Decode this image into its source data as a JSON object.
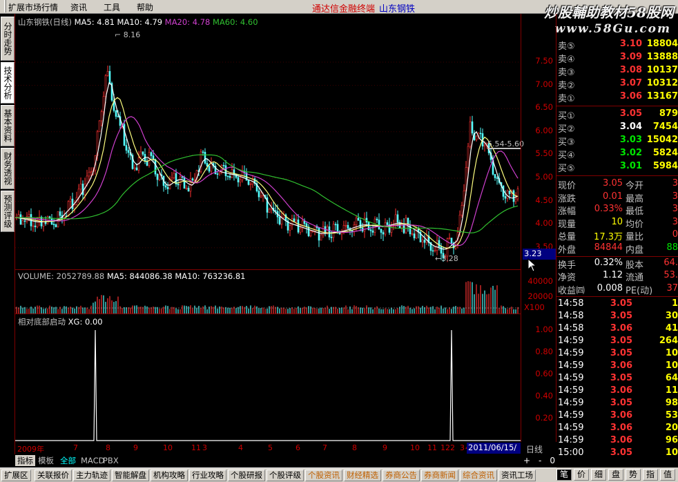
{
  "menu": [
    "扩展市场行情",
    "资讯",
    "工具",
    "帮助"
  ],
  "title": {
    "app": "通达信金融终端",
    "stock": "山东钢铁"
  },
  "watermark": {
    "line1": "炒股輔助教材58股网",
    "line2": "www.58Gu.com"
  },
  "left_tabs": [
    "分时走势",
    "技术分析",
    "基本资料",
    "财务透视",
    "预测评级"
  ],
  "main_legend": {
    "name": "山东钢铁(日线)",
    "ma5": "MA5: 4.81",
    "ma10": "MA10: 4.79",
    "ma20": "MA20: 4.78",
    "ma60": "MA60: 4.60"
  },
  "annotations": {
    "high": "8.16",
    "low": "3.28",
    "range": "5.54-5.60"
  },
  "volume_legend": {
    "vol": "VOLUME: 2052789.88",
    "ma5": "MA5: 844086.38",
    "ma10": "MA10: 763236.81"
  },
  "indicator_legend": {
    "name": "相对底部启动",
    "xg": "XG: 0.00"
  },
  "price_axis": [
    "7.50",
    "7.00",
    "6.50",
    "6.00",
    "5.50",
    "5.00",
    "4.50",
    "4.00",
    "3.50"
  ],
  "current_price_tag": "3.23",
  "volume_axis": [
    "40000",
    "20000",
    "X100"
  ],
  "indicator_axis": [
    "1.00",
    "0.80",
    "0.60",
    "0.40",
    "0.20"
  ],
  "time_axis": {
    "labels": [
      "2009年",
      "7",
      "8",
      "9",
      "10",
      "11",
      "3",
      "4",
      "5",
      "6",
      "7",
      "8",
      "9",
      "10",
      "11",
      "12",
      "2",
      "3",
      "4"
    ],
    "cursor_date": "2011/06/15/三"
  },
  "period": "日线",
  "zoom_buttons": [
    "+",
    "-",
    "0"
  ],
  "bottom_tabs": [
    "指标",
    "模板",
    "全部",
    "MACD",
    "PBX"
  ],
  "status_buttons": [
    "扩展区",
    "关联报价",
    "主力轨迹",
    "智能解盘",
    "机构攻略",
    "行业攻略",
    "个股研报",
    "个股评级",
    "个股资讯",
    "财经精选",
    "券商公告",
    "券商新闻",
    "综合资讯",
    "资讯工场"
  ],
  "quote_tabs": [
    "笔",
    "价",
    "细",
    "盘",
    "势",
    "指",
    "值"
  ],
  "order_book": {
    "sell": [
      {
        "label": "卖⑤",
        "price": "3.10",
        "vol": "18804"
      },
      {
        "label": "卖④",
        "price": "3.09",
        "vol": "13888"
      },
      {
        "label": "卖③",
        "price": "3.08",
        "vol": "10137"
      },
      {
        "label": "卖②",
        "price": "3.07",
        "vol": "10312"
      },
      {
        "label": "卖①",
        "price": "3.06",
        "vol": "13167"
      }
    ],
    "buy": [
      {
        "label": "买①",
        "price": "3.05",
        "vol": "879"
      },
      {
        "label": "买②",
        "price": "3.04",
        "vol": "7454"
      },
      {
        "label": "买③",
        "price": "3.03",
        "vol": "15042"
      },
      {
        "label": "买④",
        "price": "3.02",
        "vol": "5824"
      },
      {
        "label": "买⑤",
        "price": "3.01",
        "vol": "5984"
      }
    ]
  },
  "stats": [
    {
      "k1": "现价",
      "v1": "3.05",
      "k2": "今开",
      "v2": "3"
    },
    {
      "k1": "涨跌",
      "v1": "0.01",
      "k2": "最高",
      "v2": "3"
    },
    {
      "k1": "涨幅",
      "v1": "0.33%",
      "k2": "最低",
      "v2": "3"
    },
    {
      "k1": "现量",
      "v1": "10",
      "k2": "均价",
      "v2": "3"
    },
    {
      "k1": "总量",
      "v1": "17.3万",
      "k2": "量比",
      "v2": "0"
    },
    {
      "k1": "外盘",
      "v1": "84844",
      "k2": "内盘",
      "v2": "88"
    },
    {
      "k1": "换手",
      "v1": "0.32%",
      "k2": "股本",
      "v2": "64."
    },
    {
      "k1": "净资",
      "v1": "1.12",
      "k2": "流通",
      "v2": "53."
    },
    {
      "k1": "收益㈣",
      "v1": "0.008",
      "k2": "PE(动)",
      "v2": "37"
    }
  ],
  "ticks": [
    {
      "t": "14:58",
      "p": "3.05",
      "v": "1"
    },
    {
      "t": "14:58",
      "p": "3.05",
      "v": "30"
    },
    {
      "t": "14:58",
      "p": "3.06",
      "v": "41"
    },
    {
      "t": "14:59",
      "p": "3.05",
      "v": "264"
    },
    {
      "t": "14:59",
      "p": "3.05",
      "v": "10"
    },
    {
      "t": "14:59",
      "p": "3.06",
      "v": "10"
    },
    {
      "t": "14:59",
      "p": "3.05",
      "v": "64"
    },
    {
      "t": "14:59",
      "p": "3.06",
      "v": "11"
    },
    {
      "t": "14:59",
      "p": "3.05",
      "v": "98"
    },
    {
      "t": "14:59",
      "p": "3.06",
      "v": "53"
    },
    {
      "t": "14:59",
      "p": "3.06",
      "v": "20"
    },
    {
      "t": "14:59",
      "p": "3.06",
      "v": "96"
    },
    {
      "t": "15:00",
      "p": "3.05",
      "v": "10"
    }
  ]
}
